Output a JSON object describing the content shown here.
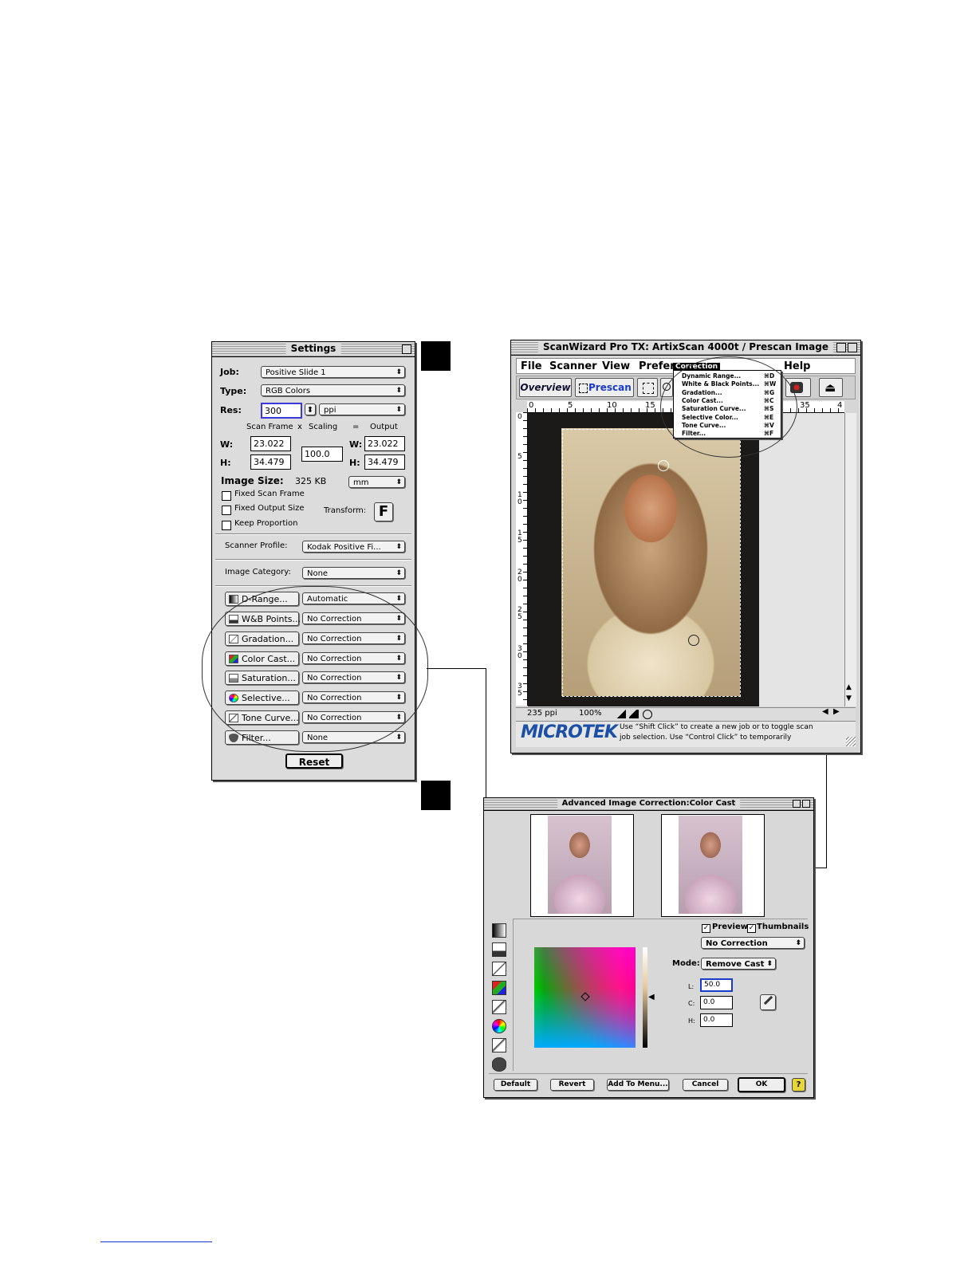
{
  "settings": {
    "title": "Settings",
    "job_label": "Job:",
    "job_value": "Positive Slide 1",
    "type_label": "Type:",
    "type_value": "RGB Colors",
    "res_label": "Res:",
    "res_value": "300",
    "res_unit": "ppi",
    "col_scan_frame": "Scan Frame",
    "col_x": "x",
    "col_scaling": "Scaling",
    "col_eq": "=",
    "col_output": "Output",
    "w_label": "W:",
    "h_label": "H:",
    "scan_w": "23.022",
    "scan_h": "34.479",
    "scaling": "100.0",
    "out_w": "23.022",
    "out_h": "34.479",
    "image_size_label": "Image Size:",
    "image_size_value": "325 KB",
    "unit": "mm",
    "fixed_scan_frame": "Fixed Scan Frame",
    "fixed_output_size": "Fixed Output Size",
    "keep_proportion": "Keep Proportion",
    "transform_label": "Transform:",
    "transform_icon": "F",
    "scanner_profile_label": "Scanner Profile:",
    "scanner_profile_value": "Kodak Positive Fi...",
    "image_category_label": "Image Category:",
    "image_category_value": "None",
    "corrections": [
      {
        "button": "D-Range...",
        "value": "Automatic",
        "icon": "drange-icon"
      },
      {
        "button": "W&B Points...",
        "value": "No Correction",
        "icon": "wb-points-icon"
      },
      {
        "button": "Gradation...",
        "value": "No Correction",
        "icon": "gradation-icon"
      },
      {
        "button": "Color Cast...",
        "value": "No Correction",
        "icon": "color-cast-icon"
      },
      {
        "button": "Saturation...",
        "value": "No Correction",
        "icon": "saturation-icon"
      },
      {
        "button": "Selective...",
        "value": "No Correction",
        "icon": "selective-icon"
      },
      {
        "button": "Tone Curve...",
        "value": "No Correction",
        "icon": "tone-curve-icon"
      },
      {
        "button": "Filter...",
        "value": "None",
        "icon": "filter-icon"
      }
    ],
    "reset": "Reset"
  },
  "scanwizard": {
    "title": "ScanWizard Pro TX: ArtixScan 4000t / Prescan Image",
    "menus": [
      "File",
      "Scanner",
      "View",
      "Prefer",
      "Correction",
      "Help"
    ],
    "correction_menu": [
      {
        "label": "Dynamic Range...",
        "key": "⌘D"
      },
      {
        "label": "White & Black Points...",
        "key": "⌘W"
      },
      {
        "label": "Gradation...",
        "key": "⌘G"
      },
      {
        "label": "Color Cast...",
        "key": "⌘C"
      },
      {
        "label": "Saturation Curve...",
        "key": "⌘S"
      },
      {
        "label": "Selective Color...",
        "key": "⌘E"
      },
      {
        "label": "Tone Curve...",
        "key": "⌘V"
      },
      {
        "label": "Filter...",
        "key": "⌘F"
      }
    ],
    "overview": "Overview",
    "prescan": "Prescan",
    "ruler_h": [
      "0",
      "5",
      "10",
      "15",
      "35",
      "4"
    ],
    "ruler_v": [
      "0",
      "5",
      "10",
      "15",
      "20",
      "25",
      "30",
      "35"
    ],
    "status_ppi": "235 ppi",
    "status_zoom": "100%",
    "brand": "MICROTEK",
    "help_text_1": "Use “Shift Click” to create a new job or to toggle scan",
    "help_text_2": "job selection. Use “Control Click” to temporarily"
  },
  "color_cast": {
    "title": "Advanced Image Correction:Color Cast",
    "preview_label": "Preview",
    "thumbnails_label": "Thumbnails",
    "preset_value": "No Correction",
    "mode_label": "Mode:",
    "mode_value": "Remove Cast",
    "l_label": "L:",
    "l_value": "50.0",
    "c_label": "C:",
    "c_value": "0.0",
    "h_label": "H:",
    "h_value": "0.0",
    "buttons": [
      "Default",
      "Revert",
      "Add To Menu...",
      "Cancel",
      "OK"
    ],
    "help_icon": "?"
  },
  "colors": {
    "accent_blue": "#1a3ccc",
    "brand_blue": "#1b4fa8"
  }
}
